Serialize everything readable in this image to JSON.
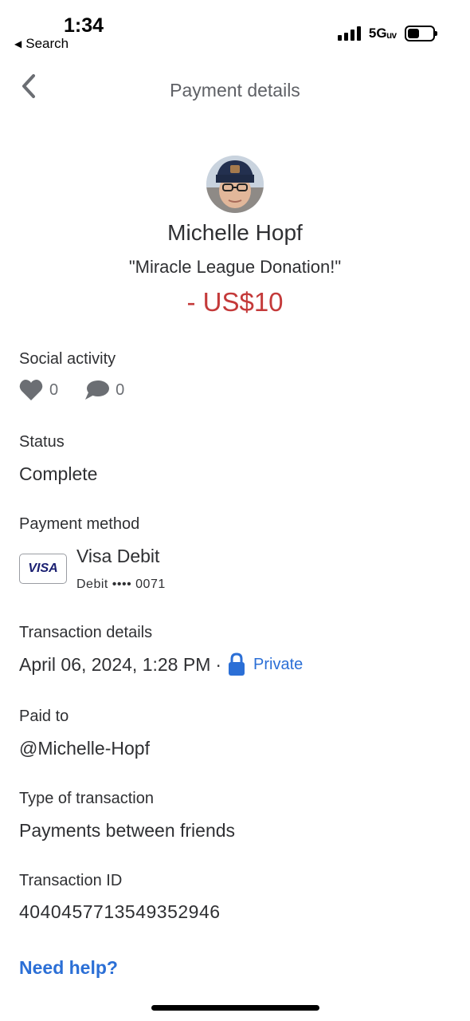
{
  "status_bar": {
    "time": "1:34",
    "back_app": "Search",
    "network": "5Gᵤᵥ"
  },
  "nav": {
    "title": "Payment details"
  },
  "profile": {
    "name": "Michelle Hopf",
    "note": "\"Miracle League Donation!\"",
    "amount": "- US$10"
  },
  "social": {
    "label": "Social activity",
    "likes": "0",
    "comments": "0"
  },
  "status": {
    "label": "Status",
    "value": "Complete"
  },
  "payment_method": {
    "label": "Payment method",
    "card_brand": "VISA",
    "name": "Visa Debit",
    "detail": "Debit •••• 0071"
  },
  "transaction_details": {
    "label": "Transaction details",
    "datetime": "April 06, 2024, 1:28 PM",
    "separator": "·",
    "privacy": "Private"
  },
  "paid_to": {
    "label": "Paid to",
    "value": "@Michelle-Hopf"
  },
  "transaction_type": {
    "label": "Type of transaction",
    "value": "Payments between friends"
  },
  "transaction_id": {
    "label": "Transaction ID",
    "value": "4040457713549352946"
  },
  "help": {
    "label": "Need help?"
  },
  "colors": {
    "accent": "#2b6fd6",
    "amount": "#c43a3a",
    "text": "#2f3033"
  }
}
